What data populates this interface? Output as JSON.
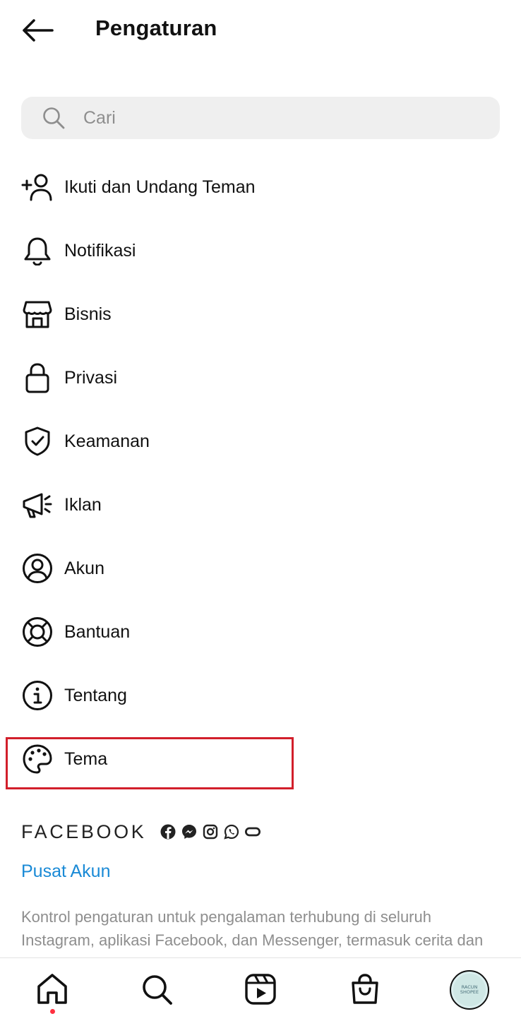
{
  "header": {
    "title": "Pengaturan"
  },
  "search": {
    "placeholder": "Cari"
  },
  "menu": [
    {
      "label": "Ikuti dan Undang Teman",
      "icon": "add-person-icon"
    },
    {
      "label": "Notifikasi",
      "icon": "bell-icon"
    },
    {
      "label": "Bisnis",
      "icon": "store-icon"
    },
    {
      "label": "Privasi",
      "icon": "lock-icon"
    },
    {
      "label": "Keamanan",
      "icon": "shield-check-icon"
    },
    {
      "label": "Iklan",
      "icon": "megaphone-icon"
    },
    {
      "label": "Akun",
      "icon": "account-circle-icon"
    },
    {
      "label": "Bantuan",
      "icon": "lifebuoy-icon"
    },
    {
      "label": "Tentang",
      "icon": "info-icon"
    },
    {
      "label": "Tema",
      "icon": "palette-icon"
    }
  ],
  "highlight": {
    "color": "#d21f2b",
    "target": "Tema"
  },
  "facebook": {
    "wordmark": "FACEBOOK",
    "app_icons": [
      "facebook-icon",
      "messenger-icon",
      "instagram-icon",
      "whatsapp-icon",
      "oculus-icon"
    ]
  },
  "accounts_center": {
    "link_label": "Pusat Akun",
    "color": "#1a8ad6"
  },
  "description": "Kontrol pengaturan untuk pengalaman terhubung di seluruh Instagram, aplikasi Facebook, dan Messenger, termasuk cerita dan",
  "tabbar": {
    "tabs": [
      "home-icon",
      "search-icon",
      "reels-icon",
      "shop-icon",
      "profile-avatar"
    ],
    "active": "home-icon",
    "avatar_text": [
      "RACUN",
      "SHOPEE"
    ]
  }
}
